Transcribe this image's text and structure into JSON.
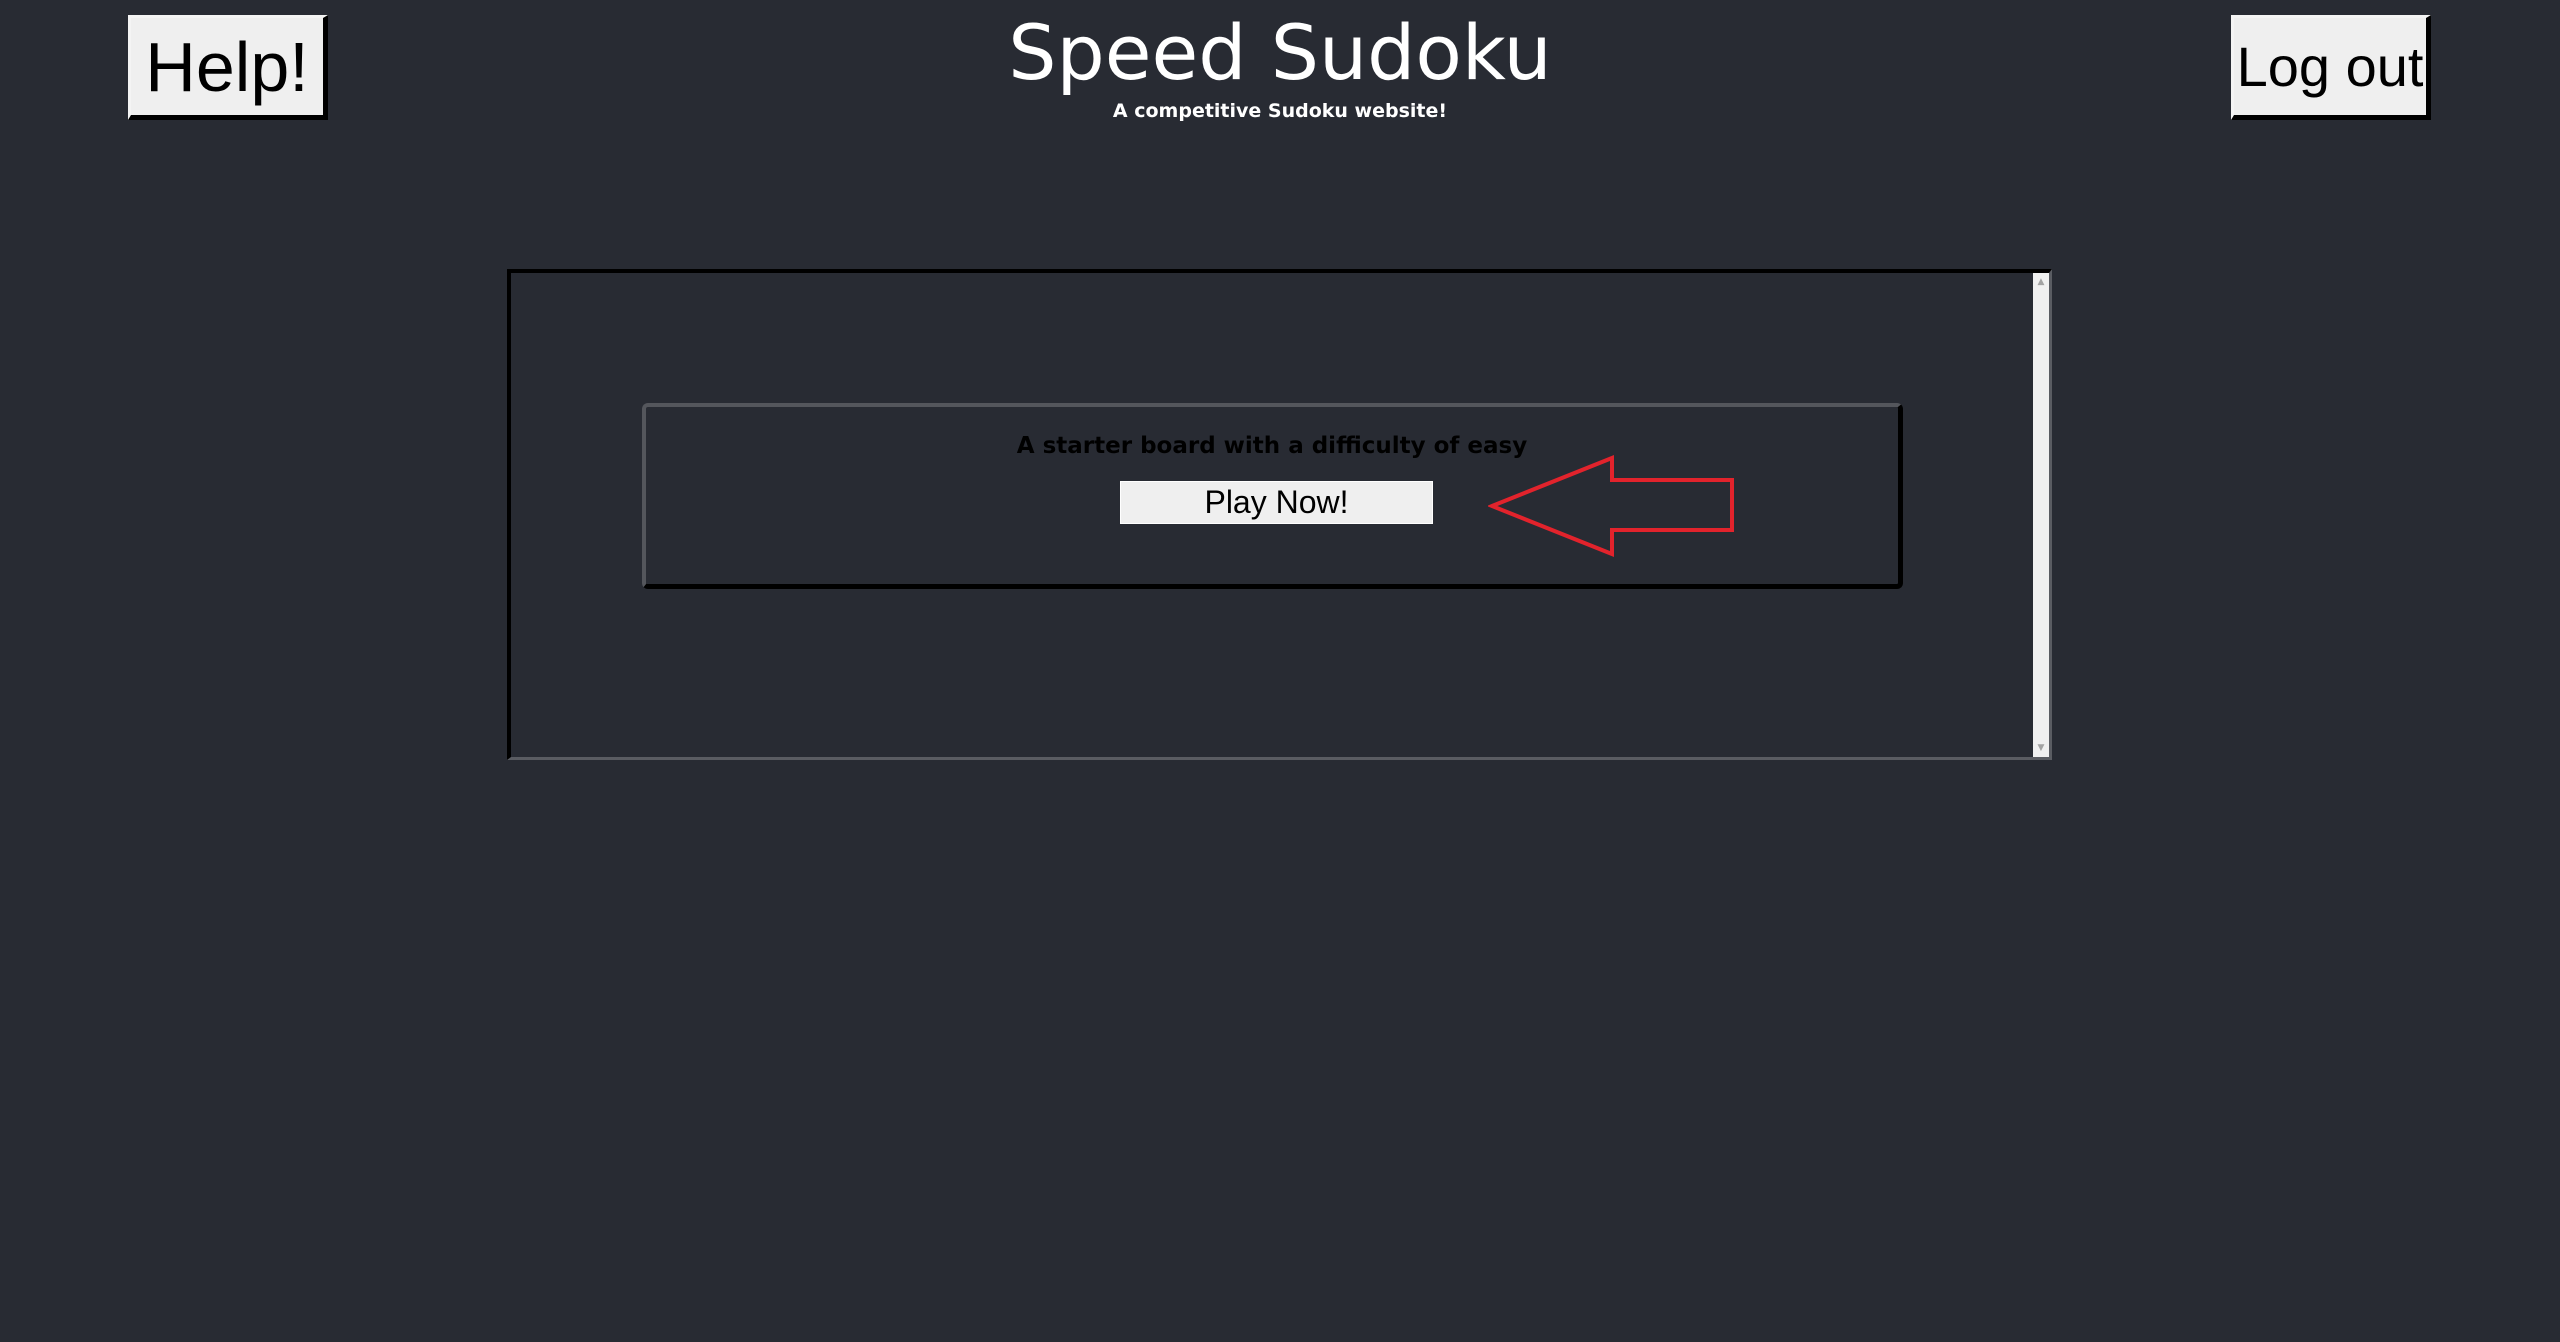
{
  "header": {
    "title": "Speed Sudoku",
    "subtitle": "A competitive Sudoku website!",
    "help_label": "Help!",
    "logout_label": "Log out"
  },
  "board_list": {
    "items": [
      {
        "description": "A starter board with a difficulty of easy",
        "play_label": "Play Now!"
      }
    ]
  },
  "annotation": {
    "arrow_color": "#e2232c"
  },
  "colors": {
    "background": "#282b33",
    "button": "#efefef",
    "text_light": "#ffffff"
  }
}
